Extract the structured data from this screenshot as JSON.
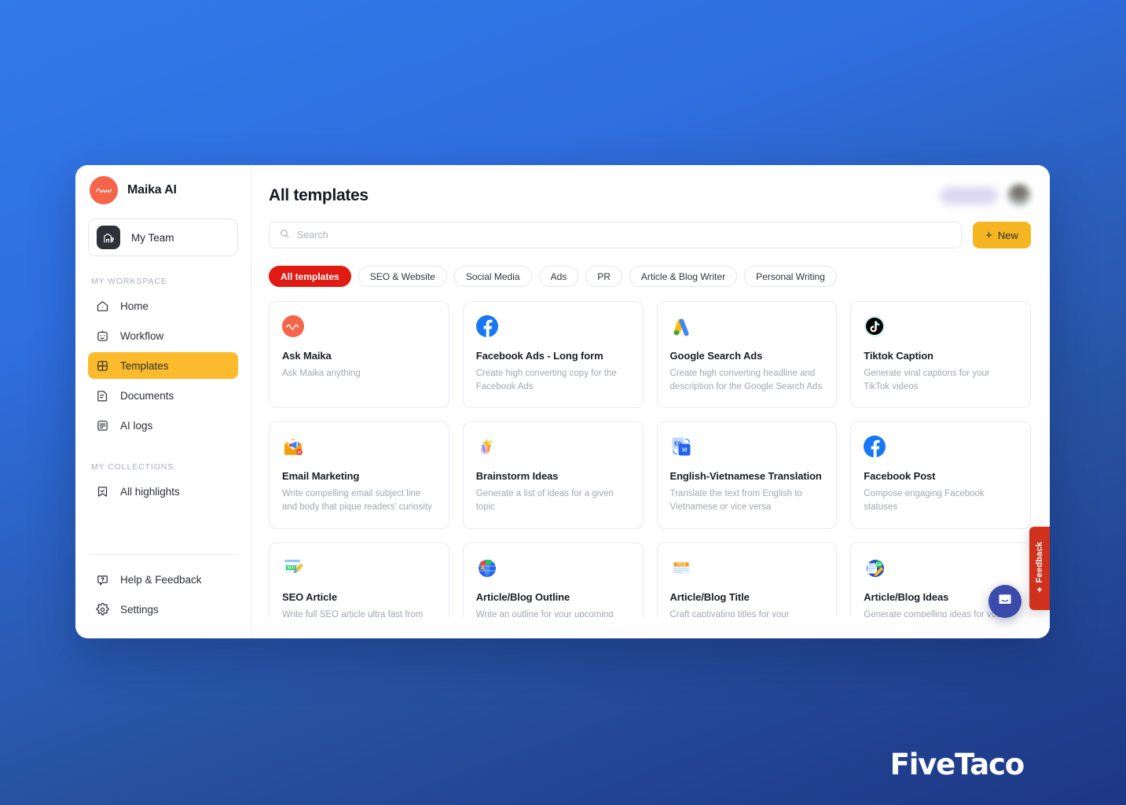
{
  "background": {
    "top_color": "#3279e9",
    "bottom_color": "#1d3786"
  },
  "sidebar": {
    "brand": {
      "name": "Maika AI",
      "avatar_icon": "maika-wave-logo",
      "avatar_color": "#f4654a"
    },
    "team_button": {
      "label": "My Team",
      "icon": "team-building-icon"
    },
    "sections": [
      {
        "title": "MY WORKSPACE",
        "items": [
          {
            "label": "Home",
            "icon": "home-icon",
            "active": false
          },
          {
            "label": "Workflow",
            "icon": "robot-face-icon",
            "active": false
          },
          {
            "label": "Templates",
            "icon": "grid-square-icon",
            "active": true
          },
          {
            "label": "Documents",
            "icon": "document-icon",
            "active": false
          },
          {
            "label": "AI logs",
            "icon": "logs-icon",
            "active": false
          }
        ]
      },
      {
        "title": "MY COLLECTIONS",
        "items": [
          {
            "label": "All highlights",
            "icon": "bookmark-check-icon",
            "active": false
          }
        ]
      }
    ],
    "footer_items": [
      {
        "label": "Help & Feedback",
        "icon": "question-circle-icon"
      },
      {
        "label": "Settings",
        "icon": "gear-icon"
      }
    ],
    "active_accent": "#fcbb2c"
  },
  "header": {
    "title": "All templates",
    "badge_blurred": true,
    "avatar_blurred": true
  },
  "search": {
    "placeholder": "Search",
    "value": "",
    "icon": "search-icon"
  },
  "new_button": {
    "label": "New",
    "icon": "plus-icon",
    "color": "#f5b622"
  },
  "filters": {
    "active_color": "#e01b13",
    "chips": [
      {
        "label": "All templates",
        "active": true
      },
      {
        "label": "SEO & Website",
        "active": false
      },
      {
        "label": "Social Media",
        "active": false
      },
      {
        "label": "Ads",
        "active": false
      },
      {
        "label": "PR",
        "active": false
      },
      {
        "label": "Article & Blog Writer",
        "active": false
      },
      {
        "label": "Personal Writing",
        "active": false
      }
    ]
  },
  "templates": [
    {
      "title": "Ask Maika",
      "desc": "Ask Maika anything",
      "icon": "maika-wave-logo"
    },
    {
      "title": "Facebook Ads - Long form",
      "desc": "Create high converting copy for the Facebook Ads",
      "icon": "facebook-icon"
    },
    {
      "title": "Google Search Ads",
      "desc": "Create high converting headline and description for the Google Search Ads",
      "icon": "google-ads-icon"
    },
    {
      "title": "Tiktok Caption",
      "desc": "Generate viral captions for your TikTok videos",
      "icon": "tiktok-icon"
    },
    {
      "title": "Email Marketing",
      "desc": "Write compelling email subject line and body that pique readers' curiosity",
      "icon": "email-megaphone-icon"
    },
    {
      "title": "Brainstorm Ideas",
      "desc": "Generate a list of ideas for a given topic",
      "icon": "brainstorm-icon"
    },
    {
      "title": "English-Vietnamese Translation",
      "desc": "Translate the text from English to Vietnamese or vice versa",
      "icon": "translate-en-vi-icon"
    },
    {
      "title": "Facebook Post",
      "desc": "Compose engaging Facebook statuses",
      "icon": "facebook-icon"
    },
    {
      "title": "SEO Article",
      "desc": "Write full SEO article ultra fast from your outline",
      "icon": "seo-pencil-icon"
    },
    {
      "title": "Article/Blog Outline",
      "desc": "Write an outline for your upcoming article or blog post",
      "icon": "blog-outline-globe-icon"
    },
    {
      "title": "Article/Blog Title",
      "desc": "Craft captivating titles for your upcoming article or blog post",
      "icon": "article-title-icon"
    },
    {
      "title": "Article/Blog Ideas",
      "desc": "Generate compelling ideas for your upcoming article or blog post",
      "icon": "article-ideas-icon"
    }
  ],
  "feedback_tab": {
    "label": "Feedback",
    "icon": "sparkles-icon",
    "color": "#d0311c"
  },
  "chat_bubble": {
    "icon": "intercom-chat-icon",
    "color": "#3b4bab"
  },
  "watermark": {
    "text": "FiveTaco"
  }
}
